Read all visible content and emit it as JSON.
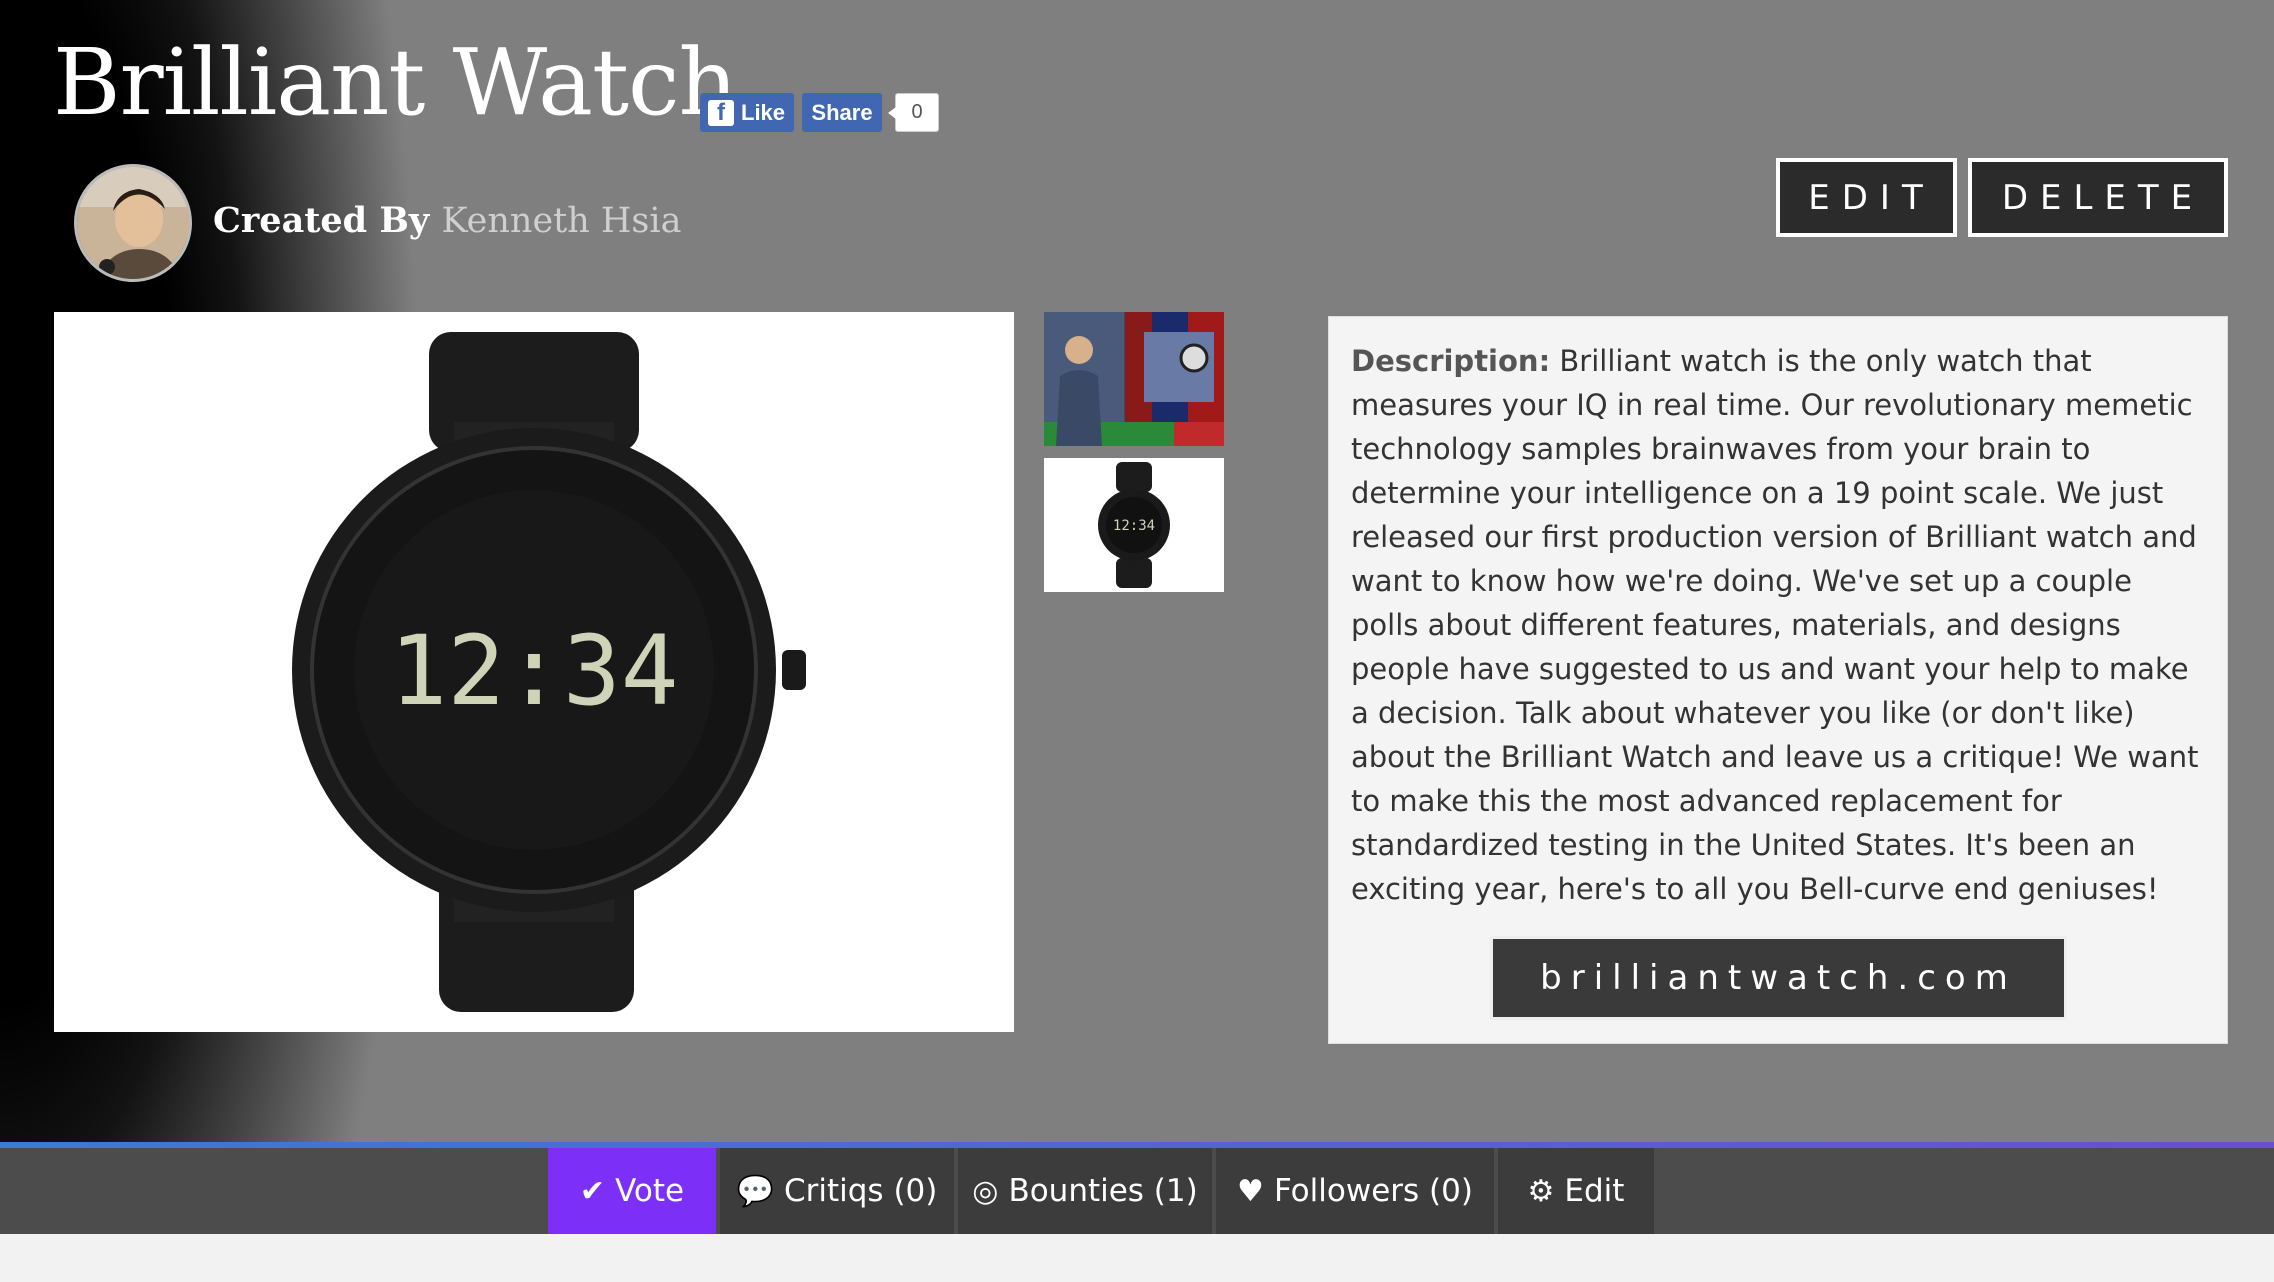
{
  "header": {
    "title": "Brilliant Watch",
    "fb_like_label": "Like",
    "fb_share_label": "Share",
    "fb_count": "0",
    "created_by_label": "Created By",
    "author": "Kenneth Hsia",
    "edit_label": "EDIT",
    "delete_label": "DELETE"
  },
  "watch_display": {
    "time": "12:34"
  },
  "description": {
    "label": "Description:",
    "text": "Brilliant watch is the only watch that measures your IQ in real time. Our revolutionary memetic technology samples brainwaves from your brain to determine your intelligence on a 19 point scale. We just released our first production version of Brilliant watch and want to know how we're doing. We've set up a couple polls about different features, materials, and designs people have suggested to us and want your help to make a decision. Talk about whatever you like (or don't like) about the Brilliant Watch and leave us a critique! We want to make this the most advanced replacement for standardized testing in the United States. It's been an exciting year, here's to all you Bell-curve end geniuses!",
    "website_label": "brilliantwatch.com"
  },
  "nav": {
    "tabs": [
      {
        "label": "Vote",
        "icon": "check-icon",
        "active": true
      },
      {
        "label": "Critiqs (0)",
        "icon": "comments-icon",
        "active": false
      },
      {
        "label": "Bounties (1)",
        "icon": "target-icon",
        "active": false
      },
      {
        "label": "Followers (0)",
        "icon": "heart-icon",
        "active": false
      },
      {
        "label": "Edit",
        "icon": "gears-icon",
        "active": false
      }
    ]
  },
  "colors": {
    "accent": "#7b2ff7",
    "facebook": "#4267b2",
    "nav_bg": "#3c3c3c"
  }
}
